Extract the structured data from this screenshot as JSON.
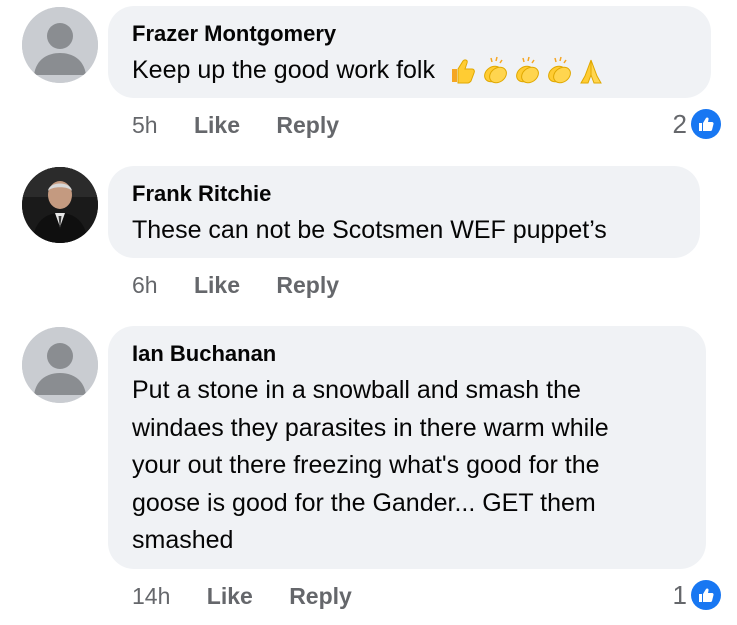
{
  "comments": [
    {
      "author": "Frazer Montgomery",
      "text": "Keep up the good work folk",
      "emojis": [
        "thumbs-up",
        "clapping-hands",
        "clapping-hands",
        "clapping-hands",
        "folded-hands"
      ],
      "time": "5h",
      "like_label": "Like",
      "reply_label": "Reply",
      "reaction_count": "2",
      "avatar": "default-avatar-icon"
    },
    {
      "author": "Frank Ritchie",
      "text": "These can not be Scotsmen WEF puppet’s",
      "time": "6h",
      "like_label": "Like",
      "reply_label": "Reply",
      "avatar": "profile-photo"
    },
    {
      "author": "Ian Buchanan",
      "text_lines": [
        "Put a stone in a snowball and smash the",
        "windaes they parasites in there warm while",
        "your out there freezing what's good for the",
        "goose is good for the Gander... GET them",
        "smashed"
      ],
      "time": "14h",
      "like_label": "Like",
      "reply_label": "Reply",
      "reaction_count": "1",
      "avatar": "default-avatar-icon"
    }
  ],
  "colors": {
    "bubble": "#f0f2f5",
    "meta_text": "#65676b",
    "like_badge": "#1877f2",
    "avatar_bg": "#c9ccd1",
    "avatar_fg": "#8a8d91"
  }
}
